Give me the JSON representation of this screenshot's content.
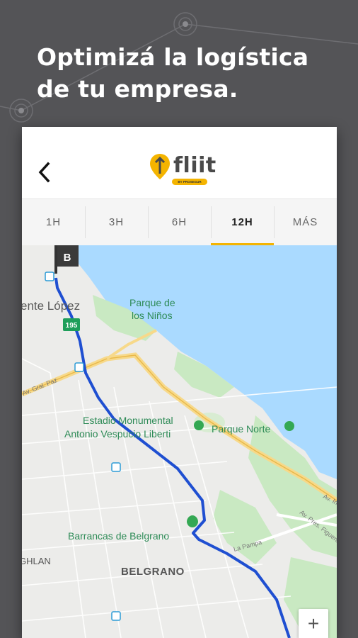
{
  "headline": {
    "line1": "Optimizá la logística",
    "line2": "de tu empresa."
  },
  "app": {
    "logo_text": "fliit",
    "logo_tagline": "BY PROSEGUR",
    "back_icon": "chevron-left-icon"
  },
  "tabs": [
    {
      "label": "1H",
      "active": false
    },
    {
      "label": "3H",
      "active": false
    },
    {
      "label": "6H",
      "active": false
    },
    {
      "label": "12H",
      "active": true
    },
    {
      "label": "MÁS",
      "active": false
    }
  ],
  "map": {
    "marker_label": "B",
    "route_shield": "195",
    "places": {
      "vicente_lopez": "ente López",
      "parque_ninos_1": "Parque de",
      "parque_ninos_2": "los Niños",
      "estadio_1": "Estadio Monumental",
      "estadio_2": "Antonio Vespucio Liberti",
      "parque_norte": "Parque Norte",
      "barrancas": "Barrancas de Belgrano",
      "belgrano": "BELGRANO",
      "ghlan": "GHLAN"
    },
    "streets": {
      "gral_paz": "Av. Gral. Paz",
      "lugones": "Av. Int",
      "figueroa": "Av. Pres. Figueroa",
      "la_pampa": "La Pampa"
    },
    "zoom_in_label": "+"
  },
  "colors": {
    "accent": "#f4b400",
    "route": "#1f4fd1",
    "water": "#aadaff",
    "park": "#c9e9c2"
  }
}
